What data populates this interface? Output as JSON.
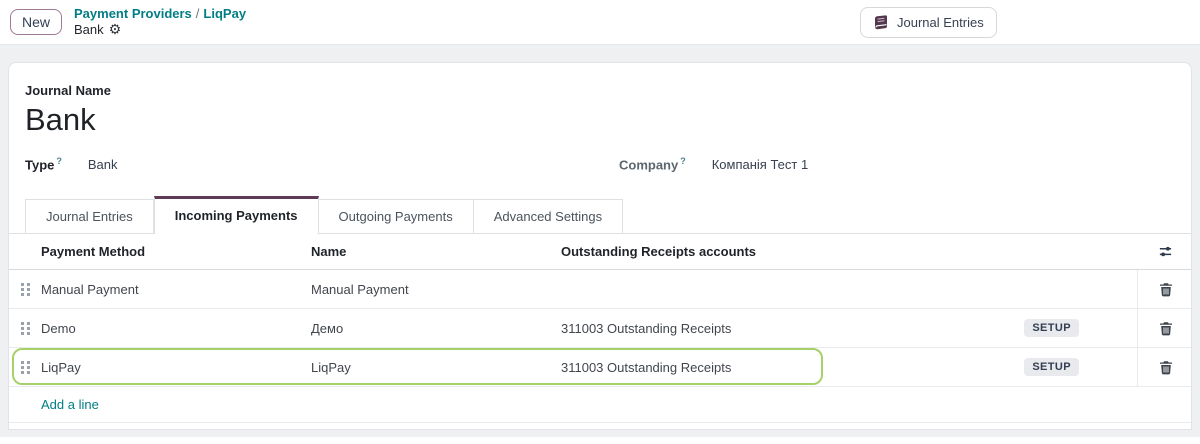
{
  "header": {
    "new_button": "New",
    "breadcrumb": {
      "parent": "Payment Providers",
      "separator": "/",
      "current": "LiqPay",
      "record": "Bank"
    },
    "journal_entries_button": "Journal Entries"
  },
  "form": {
    "journal_name_label": "Journal Name",
    "journal_name_value": "Bank",
    "type_label": "Type",
    "type_help": "?",
    "type_value": "Bank",
    "company_label": "Company",
    "company_help": "?",
    "company_value": "Компанія Тест 1"
  },
  "tabs": [
    {
      "label": "Journal Entries",
      "active": false
    },
    {
      "label": "Incoming Payments",
      "active": true
    },
    {
      "label": "Outgoing Payments",
      "active": false
    },
    {
      "label": "Advanced Settings",
      "active": false
    }
  ],
  "table": {
    "columns": [
      "Payment Method",
      "Name",
      "Outstanding Receipts accounts"
    ],
    "rows": [
      {
        "payment_method": "Manual Payment",
        "name": "Manual Payment",
        "outstanding": "",
        "setup": "",
        "highlighted": false
      },
      {
        "payment_method": "Demo",
        "name": "Демо",
        "outstanding": "311003 Outstanding Receipts",
        "setup": "SETUP",
        "highlighted": false
      },
      {
        "payment_method": "LiqPay",
        "name": "LiqPay",
        "outstanding": "311003 Outstanding Receipts",
        "setup": "SETUP",
        "highlighted": true
      }
    ],
    "add_line_label": "Add a line"
  },
  "colors": {
    "accent_teal": "#017e84",
    "brand_maroon": "#5f3a57",
    "highlight_green": "#a6d06a"
  }
}
